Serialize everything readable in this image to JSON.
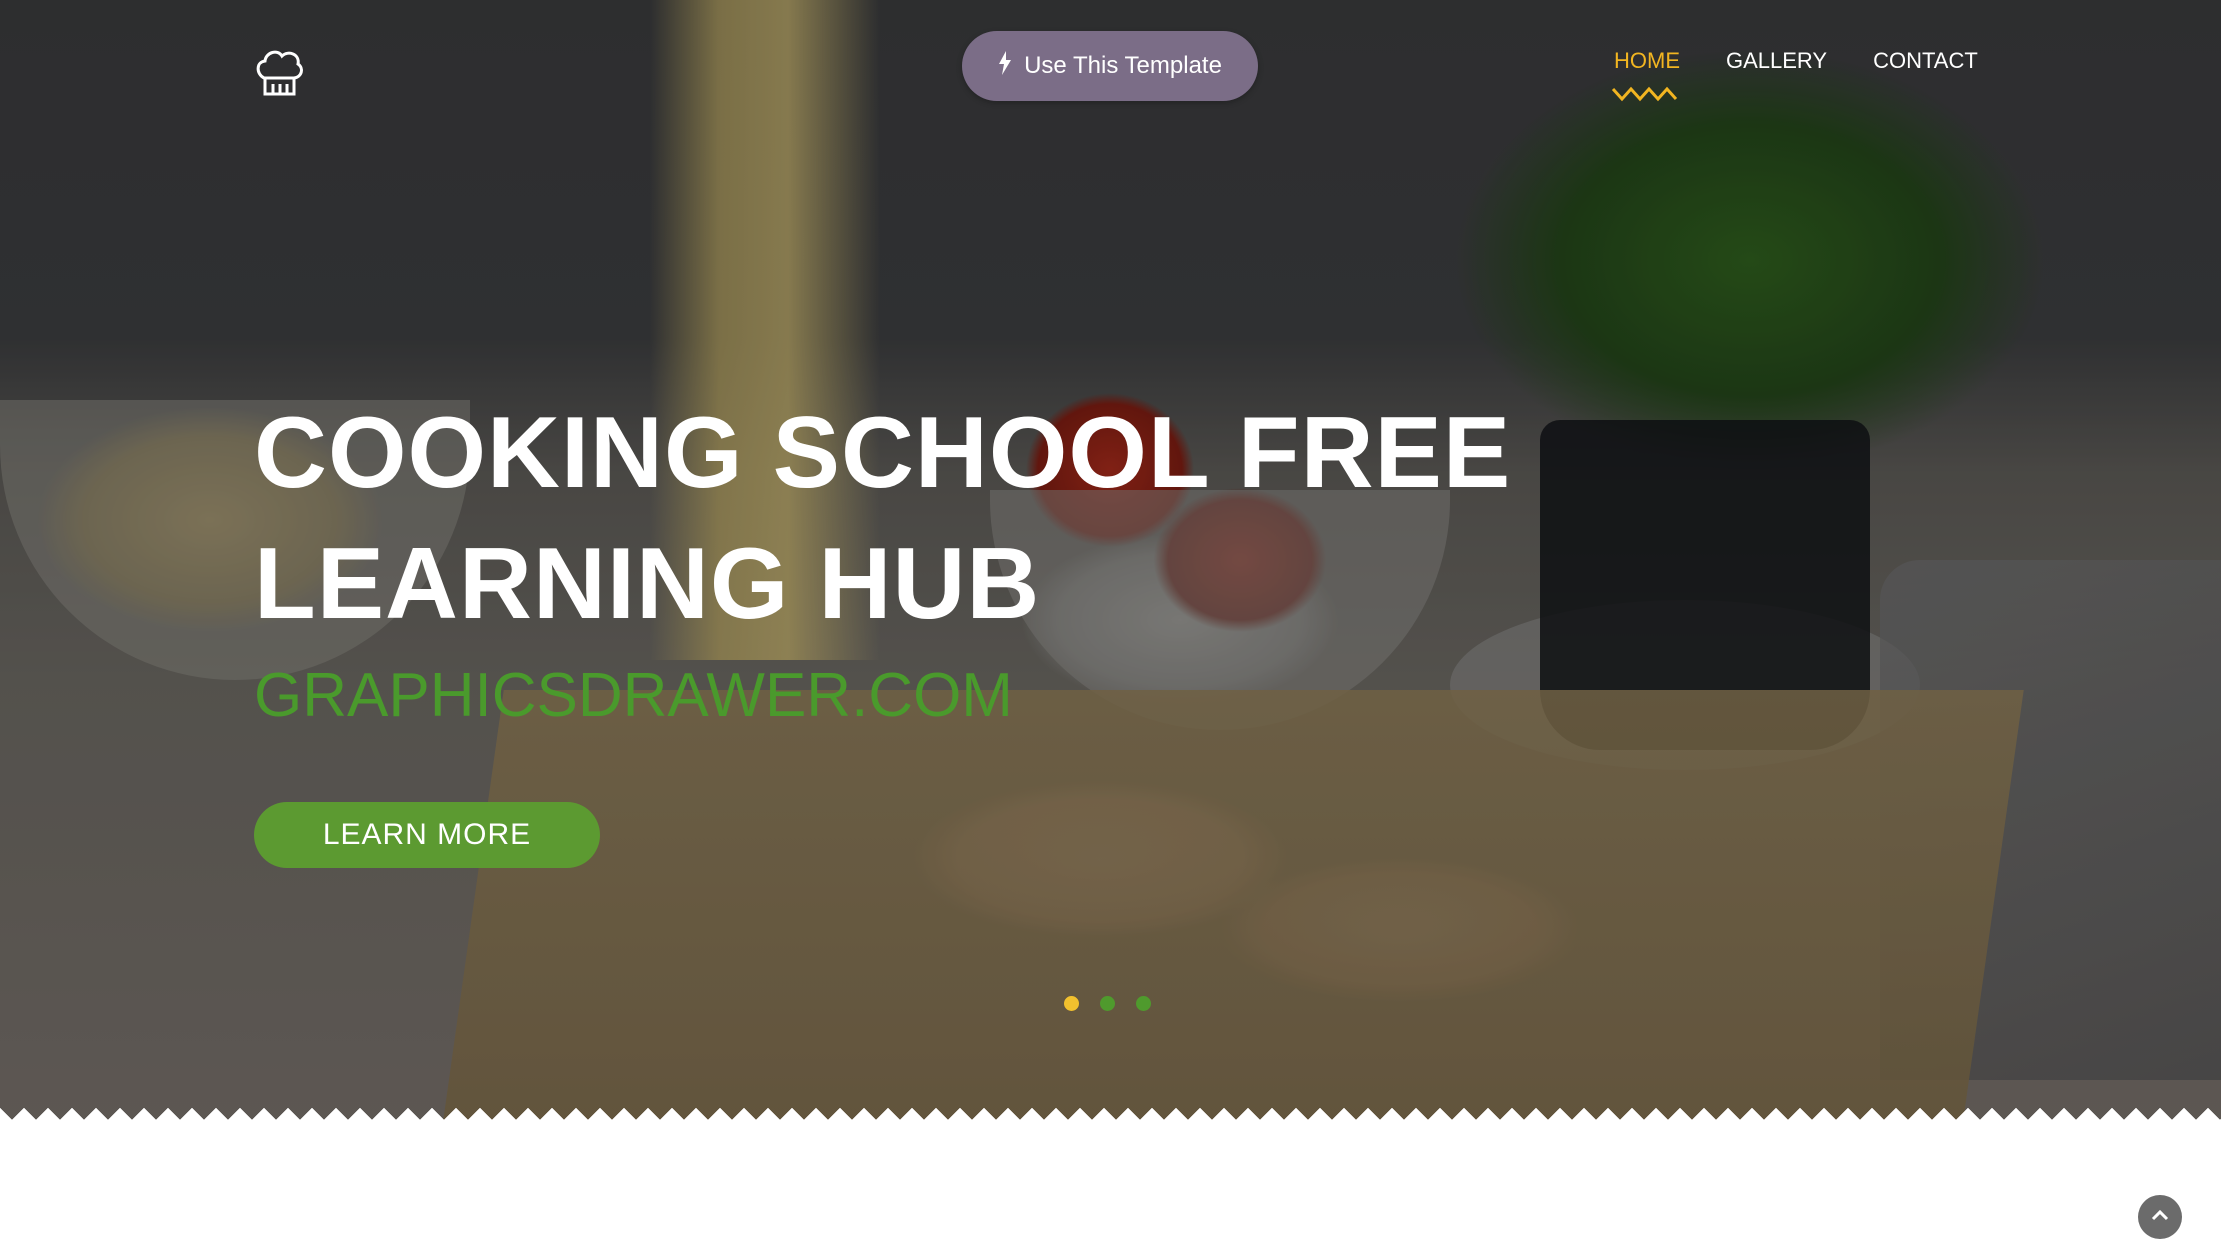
{
  "header": {
    "logo_icon": "chef-hat-icon",
    "template_button": {
      "icon": "lightning-bolt-icon",
      "label": "Use This Template"
    },
    "nav": {
      "items": [
        {
          "label": "HOME",
          "active": true
        },
        {
          "label": "GALLERY",
          "active": false
        },
        {
          "label": "CONTACT",
          "active": false
        }
      ],
      "active_color": "#f2b521"
    }
  },
  "hero": {
    "title_line1": "COOKING SCHOOL FREE",
    "title_line2": "LEARNING HUB",
    "subtitle": "GRAPHICSDRAWER.COM",
    "cta_label": "LEARN MORE",
    "slider": {
      "count": 3,
      "active_index": 0
    },
    "colors": {
      "accent_green": "#5c9a31",
      "subtitle_green": "#4a9a2c",
      "dot_active": "#f2c12e",
      "template_button_bg": "#7b6d87"
    }
  },
  "back_to_top": {
    "icon": "chevron-up-icon"
  }
}
